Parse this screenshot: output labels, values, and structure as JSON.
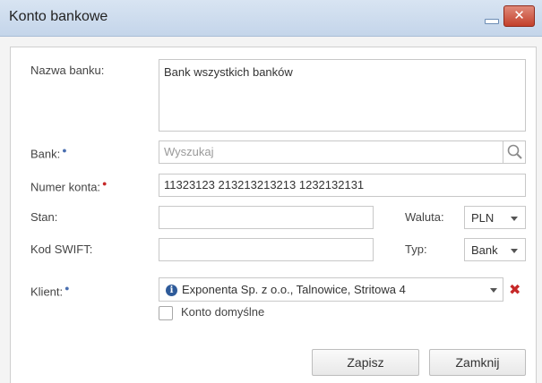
{
  "window": {
    "title": "Konto bankowe"
  },
  "form": {
    "bank_name": {
      "label": "Nazwa banku:",
      "value": "Bank wszystkich banków"
    },
    "bank": {
      "label": "Bank:",
      "placeholder": "Wyszukaj"
    },
    "account_number": {
      "label": "Numer konta:",
      "value": "11323123 213213213213 1232132131"
    },
    "state": {
      "label": "Stan:",
      "value": ""
    },
    "currency": {
      "label": "Waluta:",
      "value": "PLN"
    },
    "swift": {
      "label": "Kod SWIFT:",
      "value": ""
    },
    "type": {
      "label": "Typ:",
      "value": "Bank"
    },
    "client": {
      "label": "Klient:",
      "value": "Exponenta Sp. z o.o., Talnowice, Stritowa 4"
    },
    "default_account": {
      "label": "Konto domyślne",
      "checked": false
    }
  },
  "buttons": {
    "save": "Zapisz",
    "close": "Zamknij"
  },
  "icons": {
    "info": "info-icon",
    "required": "required-icon",
    "search": "search-icon",
    "clear": "clear-icon",
    "minimize": "minimize-icon",
    "close": "close-icon"
  },
  "colors": {
    "titlebar": "#c9d9ec",
    "close": "#c3402b",
    "required": "#c62828",
    "info": "#4a6fb0"
  }
}
